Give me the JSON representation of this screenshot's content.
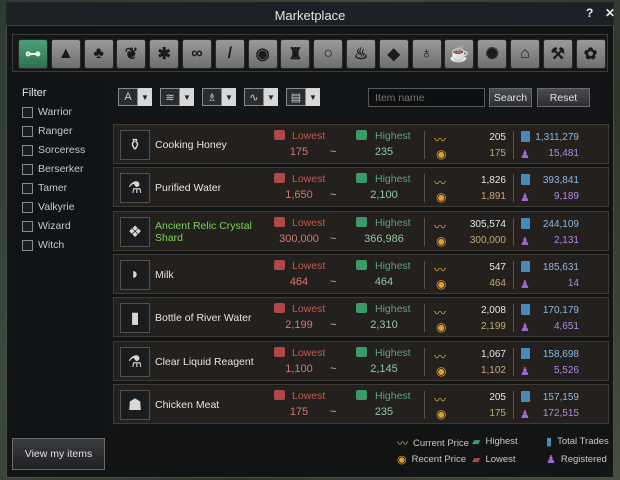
{
  "window": {
    "title": "Marketplace",
    "help_label": "?",
    "close_label": "✕"
  },
  "categories": [
    {
      "name": "all",
      "glyph": "⊶"
    },
    {
      "name": "material-ore",
      "glyph": "▲"
    },
    {
      "name": "material-wood",
      "glyph": "♣"
    },
    {
      "name": "material-leaf",
      "glyph": "❦"
    },
    {
      "name": "material-hide",
      "glyph": "✱"
    },
    {
      "name": "material-fish",
      "glyph": "∞"
    },
    {
      "name": "weapon",
      "glyph": "/"
    },
    {
      "name": "shield",
      "glyph": "◉"
    },
    {
      "name": "armor",
      "glyph": "♜"
    },
    {
      "name": "ring",
      "glyph": "○"
    },
    {
      "name": "crystal",
      "glyph": "♨"
    },
    {
      "name": "gem",
      "glyph": "◆"
    },
    {
      "name": "potion",
      "glyph": "♁"
    },
    {
      "name": "food",
      "glyph": "☕"
    },
    {
      "name": "dye",
      "glyph": "✺"
    },
    {
      "name": "furniture",
      "glyph": "⌂"
    },
    {
      "name": "tool",
      "glyph": "⚒"
    },
    {
      "name": "misc",
      "glyph": "✿"
    }
  ],
  "filter": {
    "title": "Filter",
    "classes": [
      "Warrior",
      "Ranger",
      "Sorceress",
      "Berserker",
      "Tamer",
      "Valkyrie",
      "Wizard",
      "Witch"
    ]
  },
  "toolbar": {
    "dropdowns": [
      {
        "name": "grade",
        "glyph": "A"
      },
      {
        "name": "type",
        "glyph": "≋"
      },
      {
        "name": "bag",
        "glyph": "♗"
      },
      {
        "name": "trend",
        "glyph": "∿"
      },
      {
        "name": "scroll",
        "glyph": "▤"
      }
    ],
    "search_placeholder": "Item name",
    "search_label": "Search",
    "reset_label": "Reset"
  },
  "column_labels": {
    "lowest": "Lowest",
    "highest": "Highest"
  },
  "items": [
    {
      "name": "Cooking Honey",
      "icon": "honey-jar-icon",
      "glyph": "⚱",
      "highlight": false,
      "lowest": "175",
      "highest": "235",
      "current": "205",
      "recent": "175",
      "trades": "1,311,279",
      "registered": "15,481"
    },
    {
      "name": "Purified Water",
      "icon": "flask-icon",
      "glyph": "⚗",
      "highlight": false,
      "lowest": "1,650",
      "highest": "2,100",
      "current": "1,826",
      "recent": "1,891",
      "trades": "393,841",
      "registered": "9,189"
    },
    {
      "name": "Ancient Relic Crystal Shard",
      "icon": "crystal-shard-icon",
      "glyph": "❖",
      "highlight": true,
      "lowest": "300,000",
      "highest": "366,986",
      "current": "305,574",
      "recent": "300,000",
      "trades": "244,109",
      "registered": "2,131"
    },
    {
      "name": "Milk",
      "icon": "milk-icon",
      "glyph": "◗",
      "highlight": false,
      "lowest": "464",
      "highest": "464",
      "current": "547",
      "recent": "464",
      "trades": "185,631",
      "registered": "14"
    },
    {
      "name": "Bottle of River Water",
      "icon": "bottle-icon",
      "glyph": "▮",
      "highlight": false,
      "lowest": "2,199",
      "highest": "2,310",
      "current": "2,008",
      "recent": "2,199",
      "trades": "170,179",
      "registered": "4,651"
    },
    {
      "name": "Clear Liquid Reagent",
      "icon": "reagent-flask-icon",
      "glyph": "⚗",
      "highlight": false,
      "lowest": "1,100",
      "highest": "2,145",
      "current": "1,067",
      "recent": "1,102",
      "trades": "158,698",
      "registered": "5,526"
    },
    {
      "name": "Chicken Meat",
      "icon": "meat-icon",
      "glyph": "☗",
      "highlight": false,
      "lowest": "175",
      "highest": "235",
      "current": "205",
      "recent": "175",
      "trades": "157,159",
      "registered": "172,515"
    }
  ],
  "legend": {
    "current_price": "Current Price",
    "highest": "Highest",
    "total_trades": "Total Trades",
    "recent_price": "Recent Price",
    "lowest": "Lowest",
    "registered": "Registered"
  },
  "view_button": "View my items"
}
